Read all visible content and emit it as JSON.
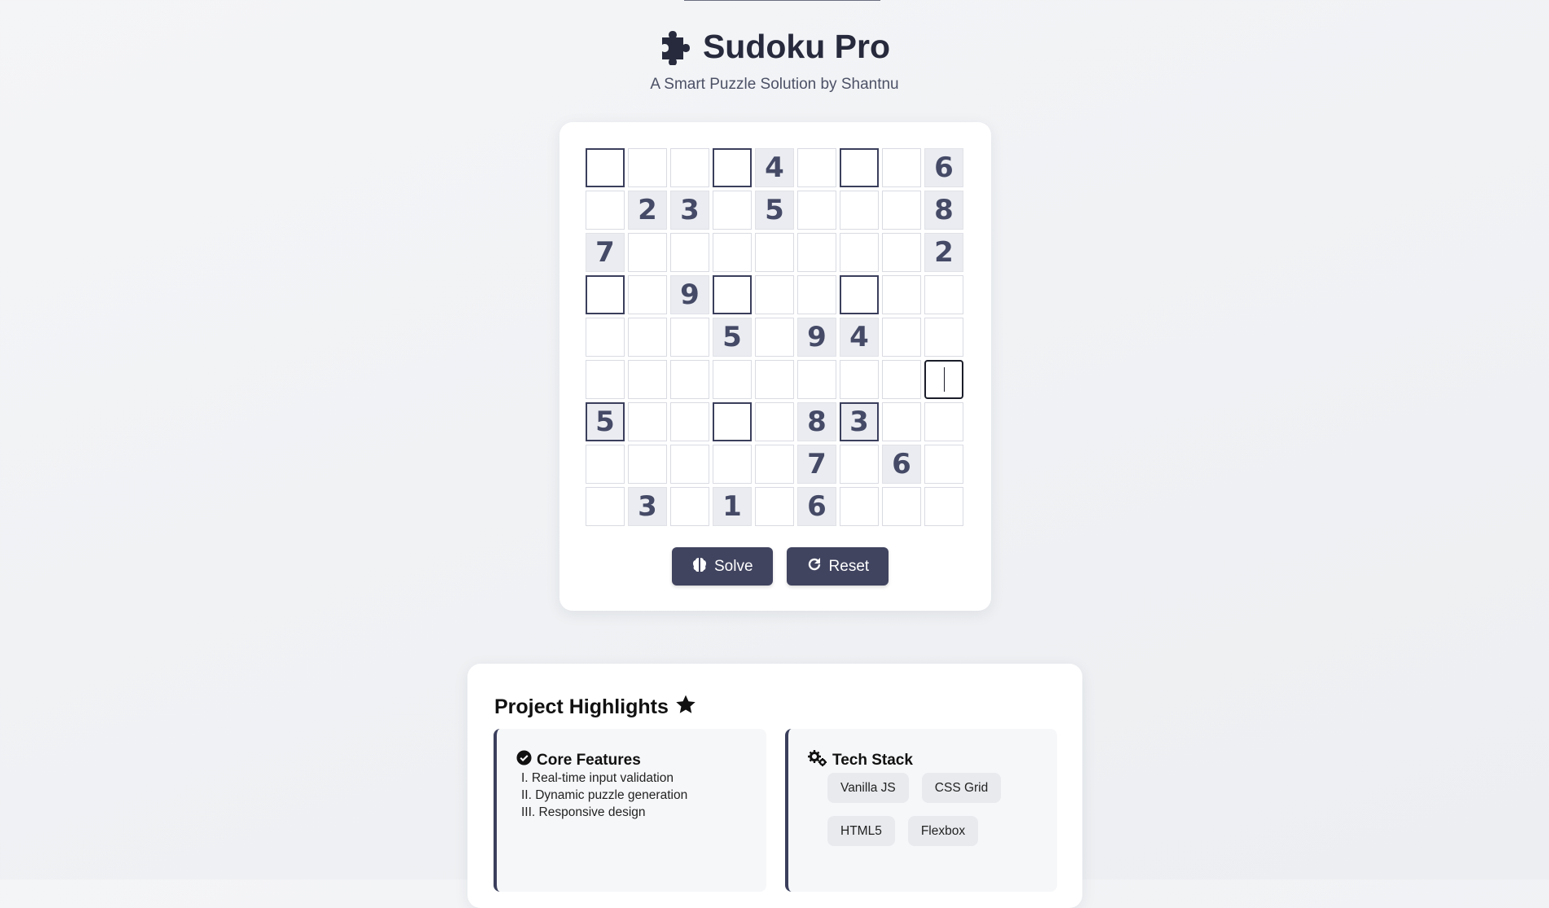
{
  "header": {
    "title": "Sudoku Pro",
    "subtitle": "A Smart Puzzle Solution by Shantnu"
  },
  "board": {
    "values": [
      [
        "",
        "",
        "",
        "",
        "4",
        "",
        "",
        "",
        "6"
      ],
      [
        "",
        "2",
        "3",
        "",
        "5",
        "",
        "",
        "",
        "8"
      ],
      [
        "7",
        "",
        "",
        "",
        "",
        "",
        "",
        "",
        "2"
      ],
      [
        "",
        "",
        "9",
        "",
        "",
        "",
        "",
        "",
        ""
      ],
      [
        "",
        "",
        "",
        "5",
        "",
        "9",
        "4",
        "",
        ""
      ],
      [
        "",
        "",
        "",
        "",
        "",
        "",
        "",
        "",
        ""
      ],
      [
        "5",
        "",
        "",
        "",
        "",
        "8",
        "3",
        "",
        ""
      ],
      [
        "",
        "",
        "",
        "",
        "",
        "7",
        "",
        "6",
        ""
      ],
      [
        "",
        "3",
        "",
        "1",
        "",
        "6",
        "",
        "",
        ""
      ]
    ],
    "focused_cell": [
      5,
      8
    ]
  },
  "buttons": {
    "solve": "Solve",
    "reset": "Reset"
  },
  "highlights": {
    "title": "Project Highlights",
    "core": {
      "title": "Core Features",
      "items": [
        "I. Real-time input validation",
        "II. Dynamic puzzle generation",
        "III. Responsive design"
      ]
    },
    "tech": {
      "title": "Tech Stack",
      "tags": [
        "Vanilla JS",
        "CSS Grid",
        "HTML5",
        "Flexbox"
      ]
    }
  },
  "colors": {
    "accent": "#41445f",
    "given_bg": "#eaecf1",
    "digit": "#454a66"
  }
}
